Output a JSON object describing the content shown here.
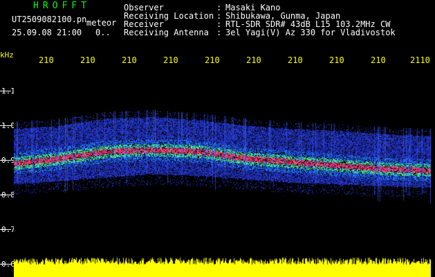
{
  "header": {
    "brand": "HROFFT",
    "filename": "UT2509082100.pn",
    "mode": "meteor",
    "datetime": "25.09.08 21:00",
    "count": "0.."
  },
  "meta": [
    {
      "label": "Observer",
      "value": "Masaki Kano"
    },
    {
      "label": "Receiving Location",
      "value": "Shibukawa, Gunma, Japan"
    },
    {
      "label": "Receiver",
      "value": "RTL-SDR SDR# 43dB L15 103.2MHz CW"
    },
    {
      "label": "Receiving Antenna",
      "value": "3el Yagi(V) Az 330 for Vladivostok"
    }
  ],
  "axis": {
    "unit": "kHz",
    "x_ticks": [
      "210",
      "210",
      "210",
      "210",
      "210",
      "210",
      "210",
      "210",
      "210",
      "2110"
    ],
    "y_ticks": [
      "1.1",
      "1.0",
      "0.9",
      "0.8",
      "0.7",
      "0.6"
    ]
  },
  "colors": {
    "background": "#000000",
    "header_green": "#00ff00",
    "axis_yellow": "#ffff00",
    "signal_red": "#ff2a6a",
    "noise_blue": "#2030c0",
    "noise_floor": "#ffff00"
  },
  "chart_data": {
    "type": "heatmap",
    "xlabel": "",
    "ylabel": "kHz",
    "ylim": [
      0.6,
      1.15
    ],
    "signal_trace": {
      "x_index": [
        0,
        1,
        2,
        3,
        4,
        5,
        6,
        7,
        8,
        9
      ],
      "freq_khz": [
        0.89,
        0.905,
        0.925,
        0.93,
        0.925,
        0.905,
        0.895,
        0.885,
        0.875,
        0.87
      ]
    },
    "band_upper_khz": [
      0.99,
      1.0,
      1.02,
      1.025,
      1.015,
      1.0,
      0.99,
      0.985,
      0.975,
      0.97
    ],
    "band_lower_khz": [
      0.83,
      0.84,
      0.85,
      0.86,
      0.855,
      0.845,
      0.835,
      0.83,
      0.825,
      0.82
    ]
  }
}
